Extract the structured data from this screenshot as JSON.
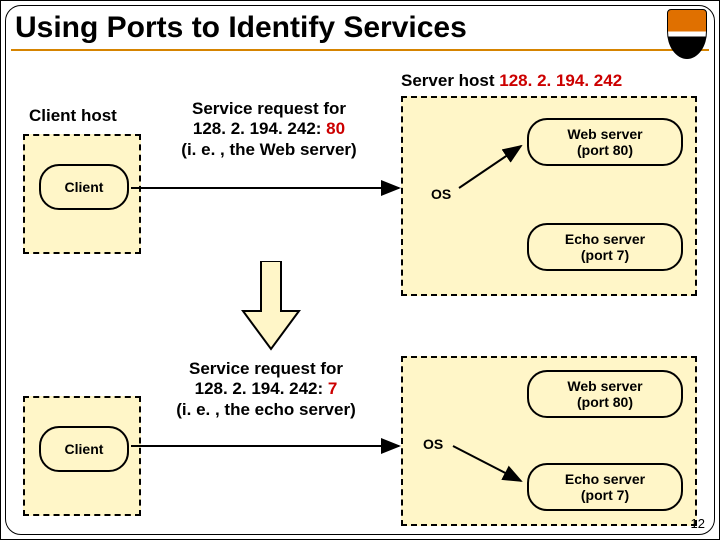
{
  "title": "Using Ports to Identify Services",
  "page_number": "12",
  "server_host_label_prefix": "Server host ",
  "server_host_ip": "128. 2. 194. 242",
  "client_host_label": "Client host",
  "client_label": "Client",
  "os_label": "OS",
  "req1": {
    "line1": "Service request for",
    "line2_plain": "128. 2. 194. 242: ",
    "line2_port": "80",
    "line3": "(i. e. , the Web server)"
  },
  "req2": {
    "line1": "Service request for",
    "line2_plain": "128. 2. 194. 242: ",
    "line2_port": "7",
    "line3": "(i. e. , the echo server)"
  },
  "webserver": {
    "name": "Web server",
    "port": "(port 80)"
  },
  "echoserver": {
    "name": "Echo server",
    "port": "(port 7)"
  }
}
